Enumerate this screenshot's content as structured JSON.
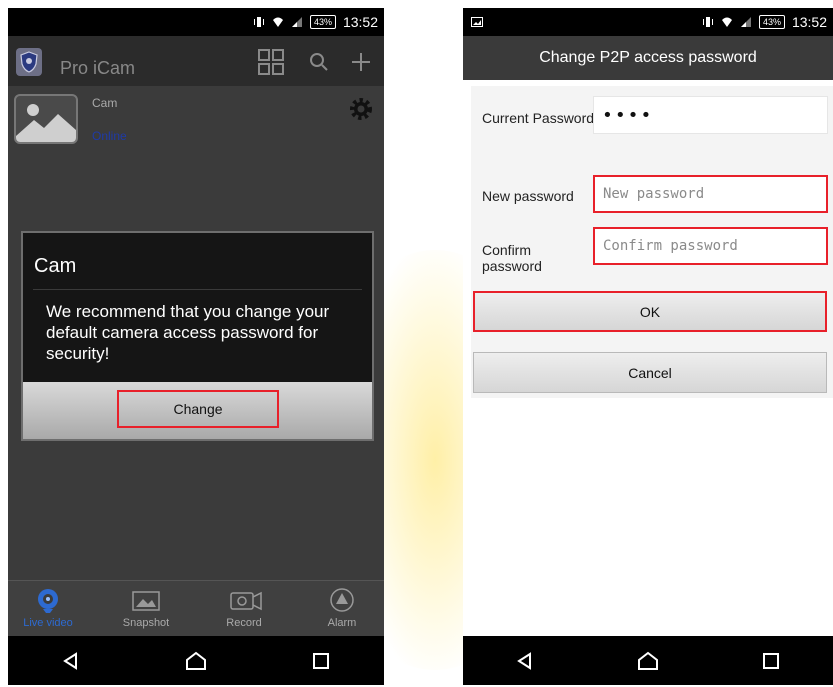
{
  "status_bar": {
    "battery": "43%",
    "time": "13:52"
  },
  "left": {
    "app_title": "Pro iCam",
    "camera": {
      "name": "Cam",
      "status": "Online"
    },
    "dialog": {
      "title": "Cam",
      "message": "We recommend that you change your default camera access password for security!",
      "button": "Change"
    },
    "tabs": [
      {
        "label": "Live video",
        "icon": "live-video-icon"
      },
      {
        "label": "Snapshot",
        "icon": "snapshot-icon"
      },
      {
        "label": "Record",
        "icon": "record-icon"
      },
      {
        "label": "Alarm",
        "icon": "alarm-icon"
      }
    ]
  },
  "right": {
    "title": "Change P2P access password",
    "current_password_label": "Current Password",
    "current_password_value": "••••",
    "new_password_label": "New password",
    "new_password_placeholder": "New password",
    "confirm_password_label": "Confirm password",
    "confirm_password_placeholder": "Confirm password",
    "ok_button": "OK",
    "cancel_button": "Cancel"
  },
  "colors": {
    "highlight": "#e8202a",
    "live_tab_accent": "#2d6ad1",
    "online_text": "#1e3aa8"
  }
}
